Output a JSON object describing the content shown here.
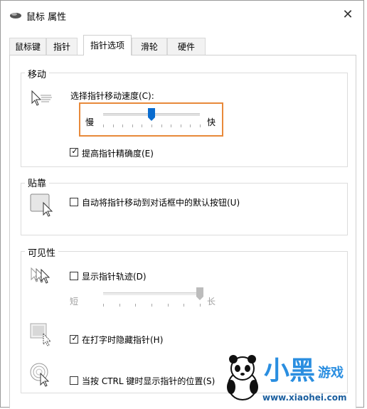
{
  "window": {
    "title": "鼠标 属性",
    "close_label": "✕"
  },
  "tabs": [
    {
      "label": "鼠标键"
    },
    {
      "label": "指针"
    },
    {
      "label": "指针选项"
    },
    {
      "label": "滑轮"
    },
    {
      "label": "硬件"
    }
  ],
  "active_tab": "指针选项",
  "motion": {
    "title": "移动",
    "speed_label": "选择指针移动速度(C):",
    "slow_label": "慢",
    "fast_label": "快",
    "speed_fraction": 0.5,
    "precision_label": "提高指针精确度(E)",
    "precision_checked": true
  },
  "snap": {
    "title": "贴靠",
    "snap_label": "自动将指针移动到对话框中的默认按钮(U)",
    "snap_checked": false
  },
  "visibility": {
    "title": "可见性",
    "trails_label": "显示指针轨迹(D)",
    "trails_checked": false,
    "short_label": "短",
    "long_label": "长",
    "trails_fraction": 1.0,
    "hide_label": "在打字时隐藏指针(H)",
    "hide_checked": true,
    "ctrl_label": "当按 CTRL 键时显示指针的位置(S)",
    "ctrl_checked": false
  },
  "watermark": {
    "brand_main": "小黑",
    "brand_sub": "游戏",
    "url": "www.xiaohei.com"
  },
  "colors": {
    "highlight": "#e8893a",
    "thumb_active": "#0a6ccf",
    "thumb_disabled": "#bcbcbc",
    "watermark_blue": "#2a8ee0"
  }
}
